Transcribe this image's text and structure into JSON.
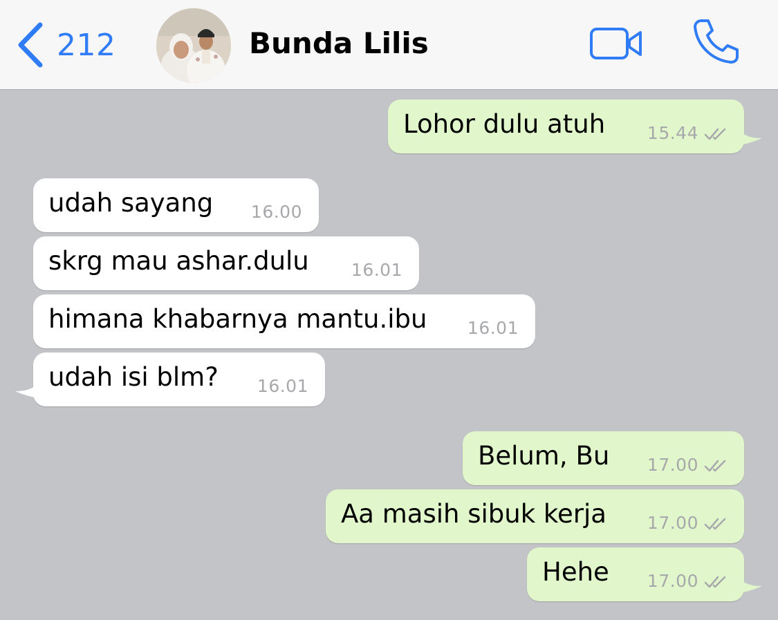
{
  "header": {
    "back_count": "212",
    "contact_name": "Bunda Lilis",
    "back_icon": "chevron-left-icon",
    "video_icon": "video-camera-icon",
    "call_icon": "phone-icon",
    "accent_color": "#2f7cf6"
  },
  "messages": [
    {
      "direction": "out",
      "text": "Lohor dulu atuh",
      "time": "15.44",
      "status": "read"
    },
    {
      "direction": "in",
      "text": "udah sayang",
      "time": "16.00"
    },
    {
      "direction": "in",
      "text": "skrg mau ashar.dulu",
      "time": "16.01"
    },
    {
      "direction": "in",
      "text": "himana khabarnya mantu.ibu",
      "time": "16.01"
    },
    {
      "direction": "in",
      "text": "udah isi blm?",
      "time": "16.01"
    },
    {
      "direction": "out",
      "text": "Belum, Bu",
      "time": "17.00",
      "status": "read"
    },
    {
      "direction": "out",
      "text": "Aa masih sibuk kerja",
      "time": "17.00",
      "status": "read"
    },
    {
      "direction": "out",
      "text": "Hehe",
      "time": "17.00",
      "status": "read"
    }
  ],
  "colors": {
    "chat_background": "#c3c4c8",
    "incoming_bubble": "#ffffff",
    "outgoing_bubble": "#e1f7cb",
    "timestamp": "#a7a8ab"
  }
}
